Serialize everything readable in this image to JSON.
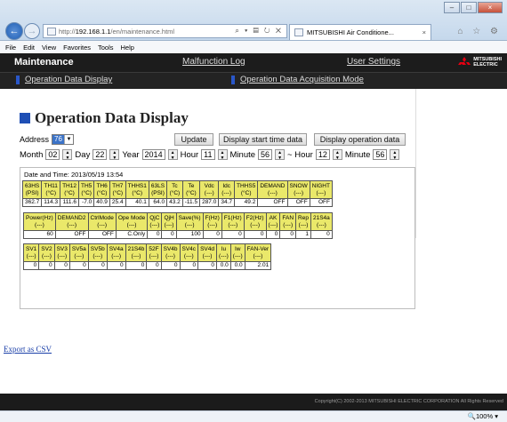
{
  "browser": {
    "url_prefix": "http://",
    "url_host": "192.168.1.1",
    "url_path": "/en/maintenance.html",
    "addr_tools": "⌕ ▾ ▤ ↻ ✕",
    "tab_title": "MITSUBISHI Air Conditione...",
    "tab_close": "×",
    "min": "–",
    "max": "□",
    "close": "×",
    "right_tools": "⌂ ☆ ⚙",
    "menu": [
      "File",
      "Edit",
      "View",
      "Favorites",
      "Tools",
      "Help"
    ],
    "zoom": "🔍100%  ▾"
  },
  "header": {
    "brand": "Maintenance",
    "malfunction_log": "Malfunction Log",
    "user_settings": "User Settings",
    "logo_text_1": "MITSUBISHI",
    "logo_text_2": "ELECTRIC",
    "sub_nav_1": "Operation Data Display",
    "sub_nav_2": "Operation Data Acquisition Mode"
  },
  "page": {
    "title": "Operation Data Display",
    "address_label": "Address",
    "address_value": "76",
    "update_button": "Update",
    "display_start_button": "Display start time data",
    "display_operation_button": "Display operation data",
    "month_label": "Month",
    "month": "02",
    "day_label": "Day",
    "day": "22",
    "year_label": "Year",
    "year": "2014",
    "hour_label": "Hour",
    "hour": "11",
    "minute_label": "Minute",
    "minute": "56",
    "tilde": "~",
    "hour2_label": "Hour",
    "hour2": "12",
    "minute2_label": "Minute",
    "minute2": "56",
    "date_time": "Date and Time:  2013/05/19 13:54",
    "export_link": "Export as CSV",
    "copyright": "Copyright(C) 2002-2013 MITSUBISHI ELECTRIC CORPORATION All Rights Reserved"
  },
  "table1": {
    "headers": [
      "63HS\n(PSI)",
      "TH11\n(°C)",
      "TH12\n(°C)",
      "TH5\n(°C)",
      "TH6\n(°C)",
      "TH7\n(°C)",
      "THHS1\n(°C)",
      "63LS\n(PSI)",
      "Tc\n(°C)",
      "Te\n(°C)",
      "Vdc\n(---)",
      "Idc\n(---)",
      "THHS5\n(°C)",
      "DEMAND\n(---)",
      "SNOW\n(---)",
      "NIGHT\n(---)"
    ],
    "values": [
      "362.7",
      "114.3",
      "111.6",
      "-7.0",
      "40.9",
      "25.4",
      "40.1",
      "64.0",
      "43.2",
      "-11.5",
      "287.0",
      "34.7",
      "49.2",
      "OFF",
      "OFF",
      "OFF"
    ]
  },
  "table2": {
    "headers": [
      "Power(Hz)\n(---)",
      "DEMAND2\n(---)",
      "CtrlMode\n(---)",
      "Ope Mode\n(---)",
      "QjC\n(---)",
      "QjH\n(---)",
      "Save(%)\n(---)",
      "F(Hz)\n(---)",
      "F1(Hz)\n(---)",
      "F2(Hz)\n(---)",
      "AK\n(---)",
      "FAN\n(---)",
      "Rep\n(---)",
      "21S4a\n(---)"
    ],
    "values": [
      "60",
      "OFF",
      "OFF",
      "C.Only",
      "0",
      "0",
      "100",
      "0",
      "0",
      "0",
      "0",
      "0",
      "1",
      "0"
    ]
  },
  "table3": {
    "headers": [
      "SV1\n(---)",
      "SV2\n(---)",
      "SV3\n(---)",
      "SV5a\n(---)",
      "SV5b\n(---)",
      "SV4a\n(---)",
      "21S4b\n(---)",
      "52F\n(---)",
      "SV4b\n(---)",
      "SV4c\n(---)",
      "SV4d\n(---)",
      "Iu\n(---)",
      "Iw\n(---)",
      "FAN-Ver\n(---)"
    ],
    "values": [
      "0",
      "0",
      "0",
      "0",
      "0",
      "0",
      "0",
      "0",
      "0",
      "0",
      "0",
      "0.0",
      "0.0",
      "2.01"
    ]
  }
}
